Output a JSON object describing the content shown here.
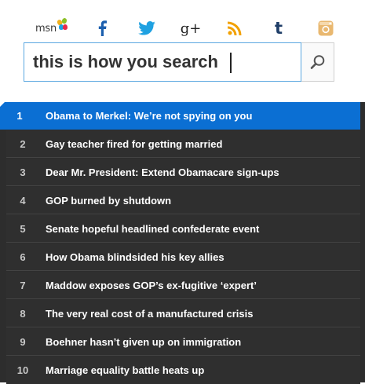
{
  "brand": {
    "logo_text": "msn"
  },
  "social": [
    {
      "name": "facebook-icon",
      "glyph": "f",
      "color": "#1c5fae"
    },
    {
      "name": "twitter-icon",
      "glyph": "",
      "color": "#1fa1e1"
    },
    {
      "name": "google-plus-icon",
      "glyph": "g+",
      "color": "#222222"
    },
    {
      "name": "rss-icon",
      "glyph": "",
      "color": "#f2a100"
    },
    {
      "name": "tumblr-icon",
      "glyph": "t",
      "color": "#1f3e68"
    },
    {
      "name": "instagram-icon",
      "glyph": "",
      "color": "#e9b870"
    }
  ],
  "search": {
    "value": "this is how you search",
    "placeholder": "",
    "button_icon": "search-icon",
    "accent": "#5aa7e0"
  },
  "trending": {
    "active_color": "#0b6fd3",
    "items": [
      {
        "num": "1",
        "title": "Obama to Merkel: We’re not spying on you"
      },
      {
        "num": "2",
        "title": "Gay teacher fired for getting married"
      },
      {
        "num": "3",
        "title": "Dear Mr. President: Extend Obamacare sign-ups"
      },
      {
        "num": "4",
        "title": "GOP burned by shutdown"
      },
      {
        "num": "5",
        "title": "Senate hopeful headlined confederate event"
      },
      {
        "num": "6",
        "title": "How Obama blindsided his key allies"
      },
      {
        "num": "7",
        "title": "Maddow exposes GOP’s ex-fugitive ‘expert’"
      },
      {
        "num": "8",
        "title": "The very real cost of a manufactured crisis"
      },
      {
        "num": "9",
        "title": "Boehner hasn’t given up on immigration"
      },
      {
        "num": "10",
        "title": "Marriage equality battle heats up"
      }
    ]
  }
}
